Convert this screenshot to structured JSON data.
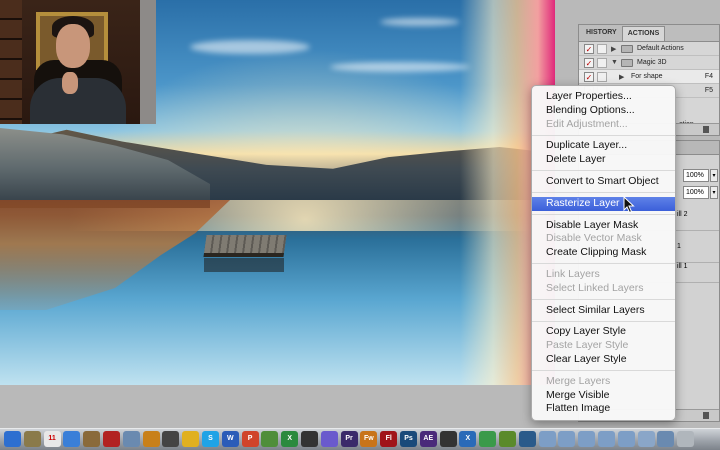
{
  "context_menu": {
    "groups": [
      [
        {
          "label": "Layer Properties...",
          "enabled": true
        },
        {
          "label": "Blending Options...",
          "enabled": true
        },
        {
          "label": "Edit Adjustment...",
          "enabled": false
        }
      ],
      [
        {
          "label": "Duplicate Layer...",
          "enabled": true
        },
        {
          "label": "Delete Layer",
          "enabled": true
        }
      ],
      [
        {
          "label": "Convert to Smart Object",
          "enabled": true
        }
      ],
      [
        {
          "label": "Rasterize Layer",
          "enabled": true,
          "highlighted": true
        }
      ],
      [
        {
          "label": "Disable Layer Mask",
          "enabled": true
        },
        {
          "label": "Disable Vector Mask",
          "enabled": false
        },
        {
          "label": "Create Clipping Mask",
          "enabled": true
        }
      ],
      [
        {
          "label": "Link Layers",
          "enabled": false
        },
        {
          "label": "Select Linked Layers",
          "enabled": false
        }
      ],
      [
        {
          "label": "Select Similar Layers",
          "enabled": true
        }
      ],
      [
        {
          "label": "Copy Layer Style",
          "enabled": true
        },
        {
          "label": "Paste Layer Style",
          "enabled": false
        },
        {
          "label": "Clear Layer Style",
          "enabled": true
        }
      ],
      [
        {
          "label": "Merge Layers",
          "enabled": false
        },
        {
          "label": "Merge Visible",
          "enabled": true
        },
        {
          "label": "Flatten Image",
          "enabled": true
        }
      ]
    ]
  },
  "actions_panel": {
    "tabs": [
      "HISTORY",
      "ACTIONS"
    ],
    "active_tab": "ACTIONS",
    "rows": [
      {
        "label": "Default Actions",
        "expanded": false,
        "key": ""
      },
      {
        "label": "Magic 3D",
        "expanded": true,
        "key": ""
      },
      {
        "label": "For shape",
        "expanded": false,
        "key": "F4"
      },
      {
        "label": "",
        "expanded": false,
        "key": "F5"
      }
    ],
    "partial_label": "ction"
  },
  "layers_panel": {
    "opacity": "100%",
    "fill": "100%",
    "layers": [
      {
        "label": "ill 2"
      },
      {
        "label": "1"
      },
      {
        "label": "ill 1"
      }
    ]
  },
  "dock": {
    "icons": [
      {
        "name": "finder-icon",
        "text": "",
        "color": "#2d6fd0"
      },
      {
        "name": "preview-icon",
        "text": "",
        "color": "#8a7a4a"
      },
      {
        "name": "calendar-icon",
        "text": "11",
        "color": "#e8e8e8"
      },
      {
        "name": "itunes-icon",
        "text": "",
        "color": "#3a7fd8"
      },
      {
        "name": "books-icon",
        "text": "",
        "color": "#8a6a3a"
      },
      {
        "name": "photo-booth-icon",
        "text": "",
        "color": "#b22222"
      },
      {
        "name": "iphoto-icon",
        "text": "",
        "color": "#6a8ab0"
      },
      {
        "name": "garageband-icon",
        "text": "",
        "color": "#c8801a"
      },
      {
        "name": "dashboard-icon",
        "text": "",
        "color": "#444"
      },
      {
        "name": "chrome-icon",
        "text": "",
        "color": "#e0b020"
      },
      {
        "name": "skype-icon",
        "text": "S",
        "color": "#1fa3e6"
      },
      {
        "name": "word-icon",
        "text": "W",
        "color": "#2b5cb8"
      },
      {
        "name": "powerpoint-icon",
        "text": "P",
        "color": "#d0442a"
      },
      {
        "name": "pen-icon",
        "text": "",
        "color": "#4f8e3a"
      },
      {
        "name": "excel-icon",
        "text": "X",
        "color": "#2b8a3e"
      },
      {
        "name": "clapper-icon",
        "text": "",
        "color": "#333"
      },
      {
        "name": "imovie-icon",
        "text": "",
        "color": "#6a5acd"
      },
      {
        "name": "premiere-icon",
        "text": "Pr",
        "color": "#3a2a6a"
      },
      {
        "name": "fireworks-icon",
        "text": "Fw",
        "color": "#c8741a"
      },
      {
        "name": "flash-icon",
        "text": "Fl",
        "color": "#a0141a"
      },
      {
        "name": "photoshop-icon",
        "text": "Ps",
        "color": "#1a4a7a"
      },
      {
        "name": "aftereffects-icon",
        "text": "AE",
        "color": "#4a2a7a"
      },
      {
        "name": "finalcut-icon",
        "text": "",
        "color": "#333"
      },
      {
        "name": "x11-icon",
        "text": "X",
        "color": "#2a6ab8"
      },
      {
        "name": "app-icon",
        "text": "",
        "color": "#3a9a4a"
      },
      {
        "name": "game-icon",
        "text": "",
        "color": "#5a8a2a"
      },
      {
        "name": "stack-icon",
        "text": "",
        "color": "#2a5a8a"
      },
      {
        "name": "folder-1-icon",
        "text": "",
        "color": "#7d9ec6"
      },
      {
        "name": "folder-2-icon",
        "text": "",
        "color": "#7d9ec6"
      },
      {
        "name": "folder-3-icon",
        "text": "",
        "color": "#7d9ec6"
      },
      {
        "name": "folder-4-icon",
        "text": "",
        "color": "#7d9ec6"
      },
      {
        "name": "folder-5-icon",
        "text": "",
        "color": "#7d9ec6"
      },
      {
        "name": "folder-6-icon",
        "text": "",
        "color": "#8aa6c8"
      },
      {
        "name": "folder-7-icon",
        "text": "",
        "color": "#6a8ab0"
      },
      {
        "name": "trash-dock-icon",
        "text": "",
        "color": "#b0b6bc"
      }
    ]
  }
}
